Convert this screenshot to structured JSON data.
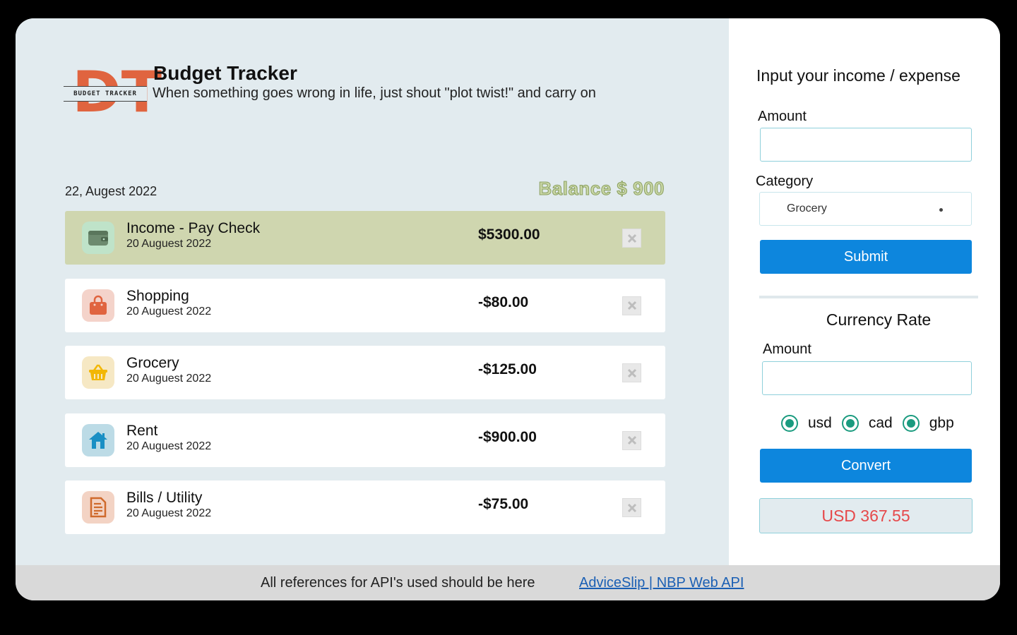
{
  "header": {
    "logo_letters": "DT",
    "logo_band": "BUDGET TRACKER",
    "title": "Budget Tracker",
    "subtitle": "When something goes wrong in life, just shout \"plot twist!\" and carry on"
  },
  "summary": {
    "date": "22, Augest 2022",
    "balance": "Balance $ 900"
  },
  "transactions": [
    {
      "name": "Income - Pay Check",
      "date": "20 Auguest 2022",
      "amount": "$5300.00",
      "icon": "wallet-icon",
      "type": "income"
    },
    {
      "name": "Shopping",
      "date": "20 Auguest 2022",
      "amount": "-$80.00",
      "icon": "shopping-bag-icon",
      "type": "expense"
    },
    {
      "name": "Grocery",
      "date": "20 Auguest 2022",
      "amount": "-$125.00",
      "icon": "basket-icon",
      "type": "expense"
    },
    {
      "name": "Rent",
      "date": "20 Auguest 2022",
      "amount": "-$900.00",
      "icon": "house-icon",
      "type": "expense"
    },
    {
      "name": "Bills / Utility",
      "date": "20 Auguest 2022",
      "amount": "-$75.00",
      "icon": "bill-icon",
      "type": "expense"
    }
  ],
  "form": {
    "title": "Input your income / expense",
    "amount_label": "Amount",
    "amount_value": "",
    "category_label": "Category",
    "category_selected": "Grocery",
    "submit_label": "Submit"
  },
  "currency": {
    "title": "Currency Rate",
    "amount_label": "Amount",
    "amount_value": "",
    "options": [
      "usd",
      "cad",
      "gbp"
    ],
    "convert_label": "Convert",
    "result": "USD 367.55"
  },
  "footer": {
    "text": "All references for API's used should be here",
    "link": "AdviceSlip | NBP Web API"
  },
  "colors": {
    "accent": "#0d86dd",
    "income_row": "#cfd6af",
    "background": "#e2ebef",
    "logo": "#e0643f",
    "result_text": "#e6484a",
    "radio": "#1a9b7f"
  }
}
